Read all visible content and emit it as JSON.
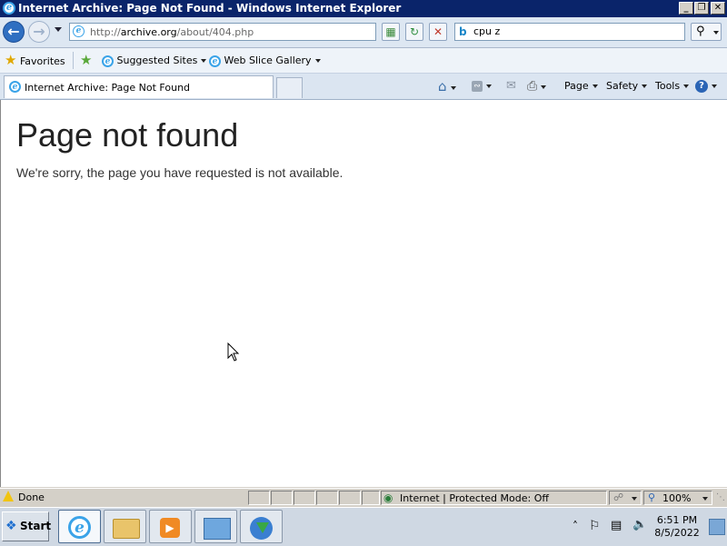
{
  "window": {
    "title": "Internet Archive: Page Not Found - Windows Internet Explorer",
    "minimize": "_",
    "maximize": "❐",
    "close": "✕"
  },
  "nav": {
    "back_icon": "back-arrow-icon",
    "forward_icon": "forward-arrow-icon",
    "address_prefix": "http://",
    "address_host": "archive.org",
    "address_path": "/about/404.php",
    "search_value": "cpu z",
    "search_provider": "b"
  },
  "favorites": {
    "favorites_label": "Favorites",
    "suggested_label": "Suggested Sites",
    "gallery_label": "Web Slice Gallery"
  },
  "tab": {
    "title": "Internet Archive: Page Not Found"
  },
  "commands": {
    "page": "Page",
    "safety": "Safety",
    "tools": "Tools"
  },
  "page": {
    "heading": "Page not found",
    "message": "We're sorry, the page you have requested is not available."
  },
  "status": {
    "text": "Done",
    "zone": "Internet | Protected Mode: Off",
    "zoom": "100%"
  },
  "taskbar": {
    "start": "Start",
    "time": "6:51 PM",
    "date": "8/5/2022"
  },
  "colors": {
    "title_bar": "#0a246a",
    "accent": "#2f6fc1"
  }
}
